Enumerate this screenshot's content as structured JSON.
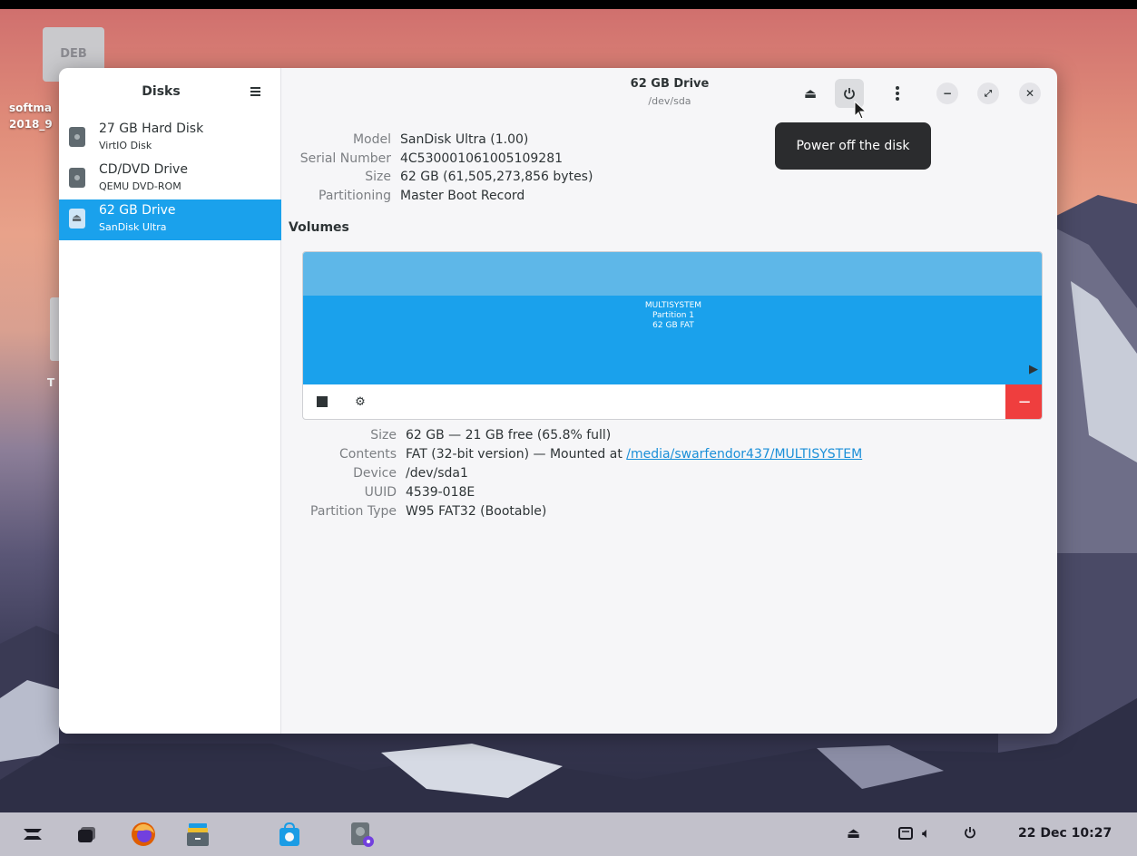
{
  "desktop": {
    "deb_icon_label": "DEB",
    "deb_file_label": "softma\n2018_9",
    "second_icon_label": "T"
  },
  "sidebar": {
    "title": "Disks",
    "devices": [
      {
        "name": "27 GB Hard Disk",
        "sub": "VirtIO Disk",
        "icon": "hard-disk-icon",
        "selected": false
      },
      {
        "name": "CD/DVD Drive",
        "sub": "QEMU DVD-ROM",
        "icon": "optical-drive-icon",
        "selected": false
      },
      {
        "name": "62 GB Drive",
        "sub": "SanDisk Ultra",
        "icon": "usb-drive-icon",
        "selected": true
      }
    ]
  },
  "header": {
    "title": "62 GB Drive",
    "subtitle": "/dev/sda",
    "tooltip": "Power off the disk"
  },
  "drive_props": [
    {
      "key": "Model",
      "value": "SanDisk Ultra (1.00)"
    },
    {
      "key": "Serial Number",
      "value": "4C530001061005109281"
    },
    {
      "key": "Size",
      "value": "62 GB (61,505,273,856 bytes)"
    },
    {
      "key": "Partitioning",
      "value": "Master Boot Record"
    }
  ],
  "volumes": {
    "label": "Volumes",
    "partition": {
      "name": "MULTISYSTEM",
      "line2": "Partition 1",
      "line3": "62 GB FAT"
    }
  },
  "volume_props": {
    "size": {
      "key": "Size",
      "value": "62 GB — 21 GB free (65.8% full)"
    },
    "contents": {
      "key": "Contents",
      "value": "FAT (32-bit version) — Mounted at ",
      "link": "/media/swarfendor437/MULTISYSTEM"
    },
    "device": {
      "key": "Device",
      "value": "/dev/sda1"
    },
    "uuid": {
      "key": "UUID",
      "value": "4539-018E"
    },
    "ptype": {
      "key": "Partition Type",
      "value": "W95 FAT32 (Bootable)"
    }
  },
  "taskbar": {
    "clock": "22 Dec 10:27"
  },
  "colors": {
    "accent": "#1aa1ec",
    "delete": "#ef3e3e",
    "link": "#1a8fd8"
  }
}
